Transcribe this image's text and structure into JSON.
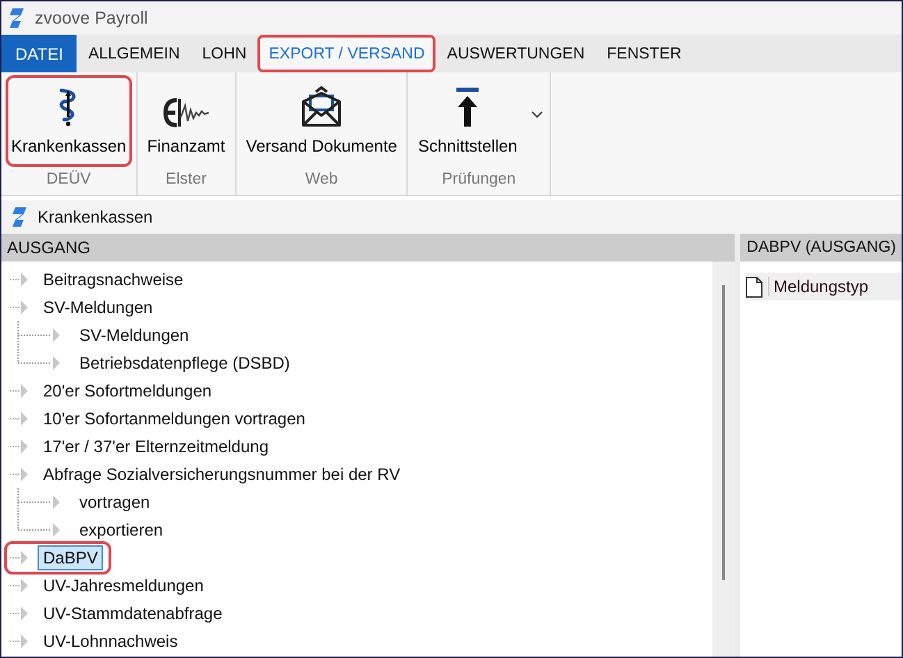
{
  "window": {
    "title": "zvoove Payroll"
  },
  "tabs": [
    {
      "label": "DATEI",
      "kind": "file",
      "selected": false,
      "marked": false
    },
    {
      "label": "ALLGEMEIN",
      "kind": "tab",
      "selected": false,
      "marked": false
    },
    {
      "label": "LOHN",
      "kind": "tab",
      "selected": false,
      "marked": false
    },
    {
      "label": "EXPORT / VERSAND",
      "kind": "tab",
      "selected": true,
      "marked": true
    },
    {
      "label": "AUSWERTUNGEN",
      "kind": "tab",
      "selected": false,
      "marked": false
    },
    {
      "label": "FENSTER",
      "kind": "tab",
      "selected": false,
      "marked": false
    }
  ],
  "ribbon": [
    {
      "group": "DEÜV",
      "button": {
        "label": "Krankenkassen",
        "marked": true,
        "has_menu": false
      }
    },
    {
      "group": "Elster",
      "button": {
        "label": "Finanzamt",
        "marked": false,
        "has_menu": false
      }
    },
    {
      "group": "Web",
      "button": {
        "label": "Versand Dokumente",
        "marked": false,
        "has_menu": false
      }
    },
    {
      "group": "Prüfungen",
      "button": {
        "label": "Schnittstellen",
        "marked": false,
        "has_menu": true
      }
    }
  ],
  "panel": {
    "title": "Krankenkassen"
  },
  "tree": {
    "header": "AUSGANG",
    "items": [
      {
        "label": "Beitragsnachweise",
        "selected": false,
        "marked": false
      },
      {
        "label": "SV-Meldungen",
        "selected": false,
        "marked": false,
        "children": [
          {
            "label": "SV-Meldungen",
            "selected": false,
            "marked": false
          },
          {
            "label": "Betriebsdatenpflege (DSBD)",
            "selected": false,
            "marked": false
          }
        ]
      },
      {
        "label": "20'er Sofortmeldungen",
        "selected": false,
        "marked": false
      },
      {
        "label": "10'er Sofortanmeldungen vortragen",
        "selected": false,
        "marked": false
      },
      {
        "label": "17'er / 37'er Elternzeitmeldung",
        "selected": false,
        "marked": false
      },
      {
        "label": "Abfrage Sozialversicherungsnummer bei der RV",
        "selected": false,
        "marked": false,
        "children": [
          {
            "label": "vortragen",
            "selected": false,
            "marked": false
          },
          {
            "label": "exportieren",
            "selected": false,
            "marked": false
          }
        ]
      },
      {
        "label": "DaBPV",
        "selected": true,
        "marked": true
      },
      {
        "label": "UV-Jahresmeldungen",
        "selected": false,
        "marked": false
      },
      {
        "label": "UV-Stammdatenabfrage",
        "selected": false,
        "marked": false
      },
      {
        "label": "UV-Lohnnachweis",
        "selected": false,
        "marked": false
      }
    ]
  },
  "detail": {
    "header": "DABPV (AUSGANG)",
    "columns": [
      "Meldungstyp"
    ]
  }
}
